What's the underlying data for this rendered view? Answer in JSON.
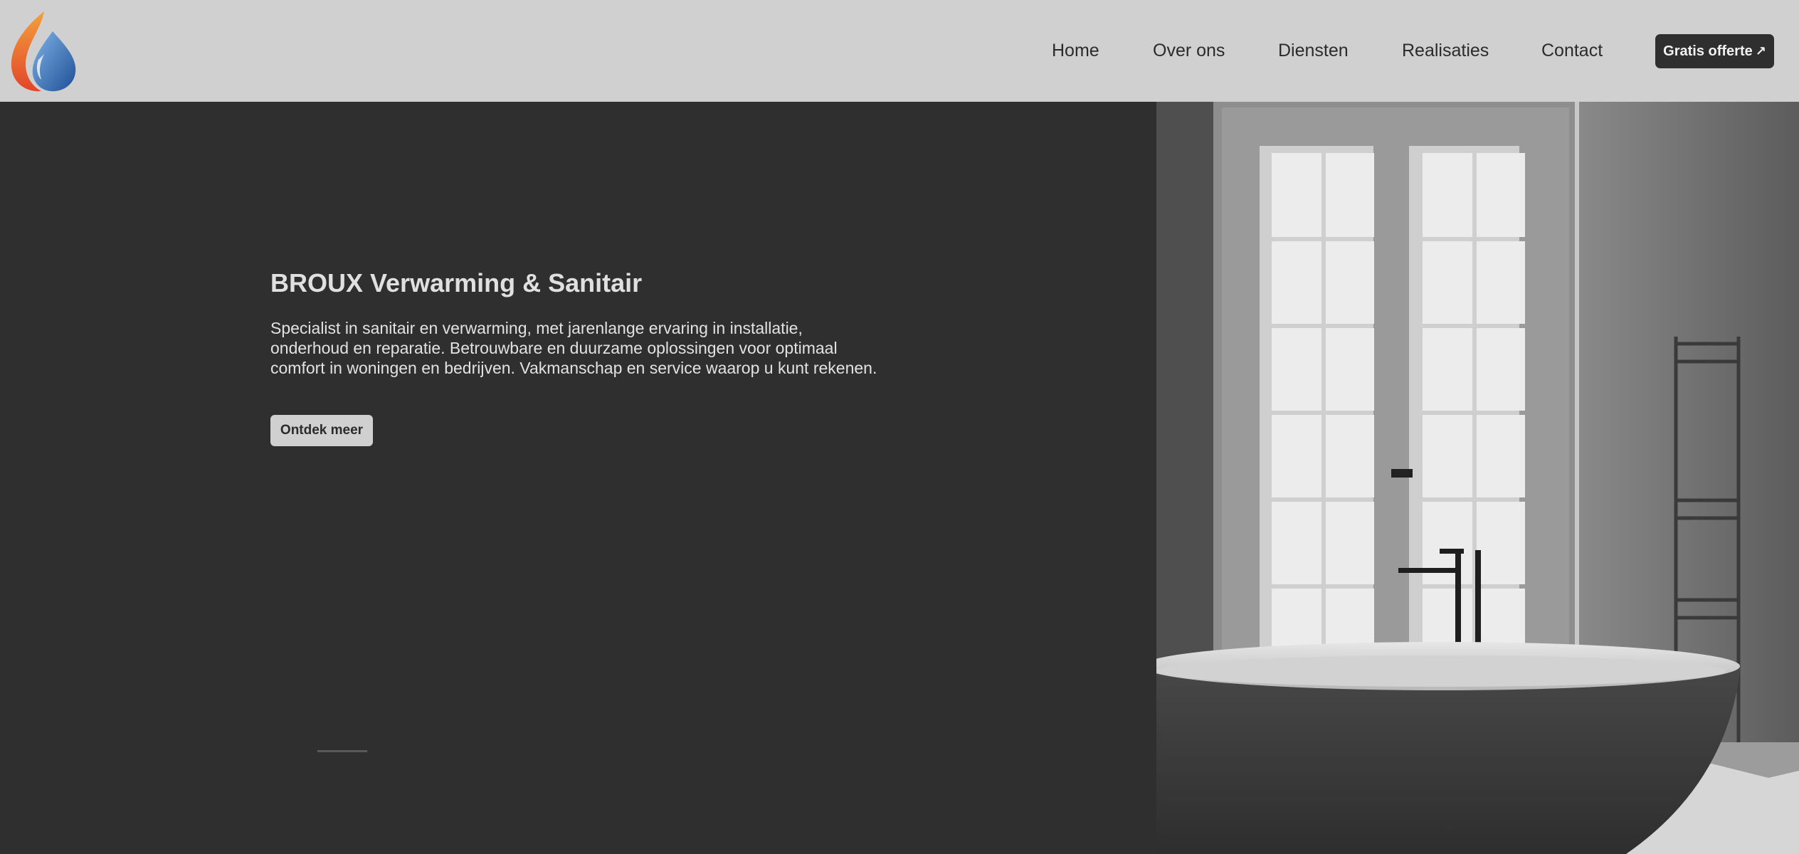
{
  "brand": {
    "logo_icon": "flame-water-drop-icon"
  },
  "nav": {
    "items": [
      {
        "label": "Home"
      },
      {
        "label": "Over ons"
      },
      {
        "label": "Diensten"
      },
      {
        "label": "Realisaties"
      },
      {
        "label": "Contact"
      }
    ],
    "cta_label": "Gratis offerte",
    "cta_icon": "arrow-up-right-icon"
  },
  "hero": {
    "title": "BROUX Verwarming & Sanitair",
    "description": "Specialist in sanitair en verwarming, met jarenlange ervaring in installatie, onderhoud en reparatie. Betrouwbare en duurzame oplossingen voor optimaal comfort in woningen en bedrijven. Vakmanschap en service waarop u kunt rekenen.",
    "button_label": "Ontdek meer"
  },
  "colors": {
    "header_bg": "#d0d0d0",
    "hero_bg": "#2f2f2f",
    "flame_orange": "#e8562a",
    "drop_blue": "#2f6fb5"
  }
}
